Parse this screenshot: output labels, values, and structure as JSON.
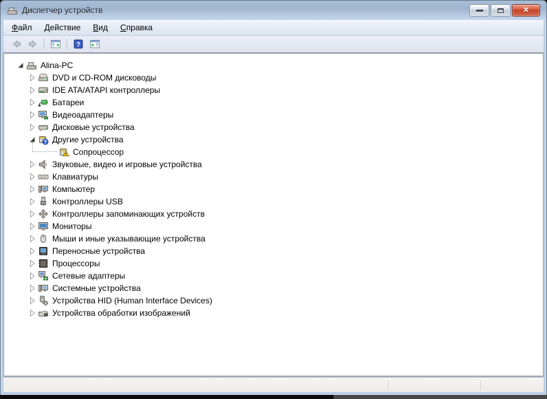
{
  "window": {
    "title": "Диспетчер устройств",
    "app_icon": "device-manager-icon",
    "controls": [
      {
        "name": "minimize",
        "icon": "minimize-icon"
      },
      {
        "name": "maximize",
        "icon": "maximize-icon"
      },
      {
        "name": "close",
        "icon": "close-icon"
      }
    ]
  },
  "menu": {
    "items": [
      {
        "id": "file",
        "label": "Файл"
      },
      {
        "id": "action",
        "label": "Действие"
      },
      {
        "id": "view",
        "label": "Вид"
      },
      {
        "id": "help",
        "label": "Справка"
      }
    ]
  },
  "toolbar": {
    "items": [
      {
        "type": "button",
        "id": "back",
        "icon": "back-icon"
      },
      {
        "type": "button",
        "id": "forward",
        "icon": "forward-icon"
      },
      {
        "type": "separator"
      },
      {
        "type": "button",
        "id": "console-tree",
        "icon": "console-tree-icon"
      },
      {
        "type": "separator"
      },
      {
        "type": "button",
        "id": "help",
        "icon": "help-icon"
      },
      {
        "type": "button",
        "id": "action-pane",
        "icon": "action-pane-icon"
      }
    ]
  },
  "tree": {
    "items": [
      {
        "id": "alina-pc",
        "label": "Alina-PC",
        "icon": "computer-icon",
        "level": 0,
        "expander": "expanded"
      },
      {
        "id": "dvd-cd-rom",
        "label": "DVD и CD-ROM дисководы",
        "icon": "cd-drive-icon",
        "level": 1,
        "expander": "collapsed"
      },
      {
        "id": "ide-ata-atapi",
        "label": "IDE ATA/ATAPI контроллеры",
        "icon": "ide-controller-icon",
        "level": 1,
        "expander": "collapsed"
      },
      {
        "id": "batteries",
        "label": "Батареи",
        "icon": "battery-icon",
        "level": 1,
        "expander": "collapsed"
      },
      {
        "id": "video-adapters",
        "label": "Видеоадаптеры",
        "icon": "display-adapter-icon",
        "level": 1,
        "expander": "collapsed"
      },
      {
        "id": "disk-drives",
        "label": "Дисковые устройства",
        "icon": "disk-drive-icon",
        "level": 1,
        "expander": "collapsed"
      },
      {
        "id": "other-devices",
        "label": "Другие устройства",
        "icon": "unknown-device-icon",
        "level": 1,
        "expander": "expanded"
      },
      {
        "id": "coprocessor",
        "label": "Сопроцессор",
        "icon": "warning-device-icon",
        "level": 2,
        "expander": "none"
      },
      {
        "id": "sound-video-game",
        "label": "Звуковые, видео и игровые устройства",
        "icon": "speaker-icon",
        "level": 1,
        "expander": "collapsed"
      },
      {
        "id": "keyboards",
        "label": "Клавиатуры",
        "icon": "keyboard-icon",
        "level": 1,
        "expander": "collapsed"
      },
      {
        "id": "computer",
        "label": "Компьютер",
        "icon": "pc-icon",
        "level": 1,
        "expander": "collapsed"
      },
      {
        "id": "usb-controllers",
        "label": "Контроллеры USB",
        "icon": "usb-icon",
        "level": 1,
        "expander": "collapsed"
      },
      {
        "id": "storage-controllers",
        "label": "Контроллеры запоминающих устройств",
        "icon": "storage-controller-icon",
        "level": 1,
        "expander": "collapsed"
      },
      {
        "id": "monitors",
        "label": "Мониторы",
        "icon": "monitor-icon",
        "level": 1,
        "expander": "collapsed"
      },
      {
        "id": "mice",
        "label": "Мыши и иные указывающие устройства",
        "icon": "mouse-icon",
        "level": 1,
        "expander": "collapsed"
      },
      {
        "id": "portable-devices",
        "label": "Переносные устройства",
        "icon": "portable-device-icon",
        "level": 1,
        "expander": "collapsed"
      },
      {
        "id": "processors",
        "label": "Процессоры",
        "icon": "processor-icon",
        "level": 1,
        "expander": "collapsed"
      },
      {
        "id": "network-adapters",
        "label": "Сетевые адаптеры",
        "icon": "network-adapter-icon",
        "level": 1,
        "expander": "collapsed"
      },
      {
        "id": "system-devices",
        "label": "Системные устройства",
        "icon": "system-device-icon",
        "level": 1,
        "expander": "collapsed"
      },
      {
        "id": "hid-devices",
        "label": "Устройства HID (Human Interface Devices)",
        "icon": "hid-device-icon",
        "level": 1,
        "expander": "collapsed"
      },
      {
        "id": "imaging-devices",
        "label": "Устройства обработки изображений",
        "icon": "imaging-device-icon",
        "level": 1,
        "expander": "collapsed"
      }
    ]
  },
  "status_bar": {
    "text": ""
  },
  "colors": {
    "titlebar_top": "#a9bed6",
    "titlebar_bottom": "#c6d6ea",
    "window_border": "#b9cfe8",
    "close_button_red": "#c23f24",
    "help_blue": "#3a5bc4",
    "warning_yellow": "#f7d13e",
    "unknown_badge_blue": "#3d6fd6",
    "menu_bar_bg": "#dce2ef",
    "status_bar_bg": "#edeae7",
    "tree_bg": "#ffffff"
  }
}
